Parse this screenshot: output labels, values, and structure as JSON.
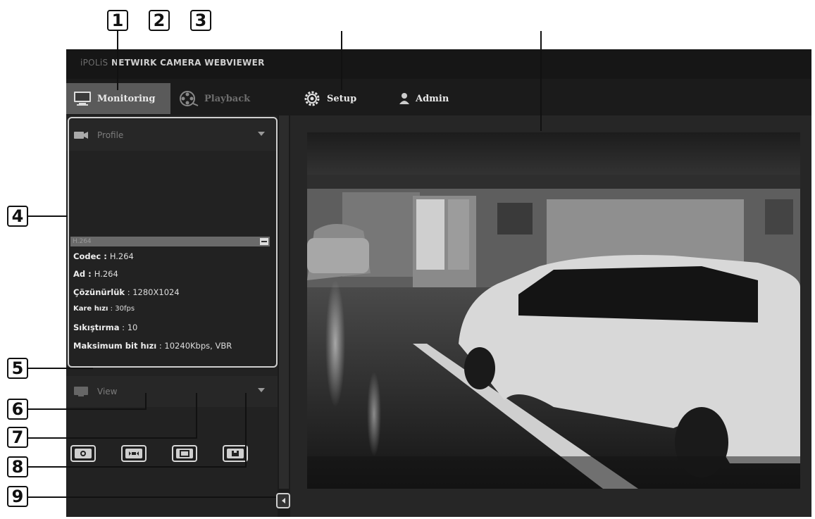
{
  "callouts": {
    "n1": "1",
    "n2": "2",
    "n3": "3",
    "n4": "4",
    "n5": "5",
    "n6": "6",
    "n7": "7",
    "n8": "8",
    "n9": "9"
  },
  "app": {
    "title_prefix": "iPOLiS",
    "title_main": "NETWIRK CAMERA WEBVIEWER"
  },
  "tabs": [
    {
      "label": "Monitoring",
      "icon": "monitor-icon",
      "active": true
    },
    {
      "label": "Playback",
      "icon": "film-reel-icon",
      "active": false
    },
    {
      "label": "Setup",
      "icon": "gear-icon",
      "active": false
    },
    {
      "label": "Admin",
      "icon": "user-icon",
      "active": false
    }
  ],
  "profile": {
    "header": "Profile",
    "selected": "H.264",
    "rows": [
      {
        "key": "Codec",
        "value": "H.264"
      },
      {
        "key": "Ad",
        "value": "H.264"
      },
      {
        "key": "Çözünürlük",
        "value": "1280X1024"
      },
      {
        "key": "Kare hızı",
        "value": "30fps"
      },
      {
        "key": "Sıkıştırma",
        "value": "10"
      },
      {
        "key": "Maksimum bit hızı",
        "value": "10240Kbps, VBR"
      }
    ]
  },
  "view": {
    "header": "View",
    "buttons": [
      "capture-icon",
      "fullscreen-icon",
      "fit-icon",
      "record-icon"
    ]
  },
  "colors": {
    "app_bg": "#1b1b1b",
    "active_tab": "#5a5a5a",
    "callout_border": "#cfcfcf"
  }
}
